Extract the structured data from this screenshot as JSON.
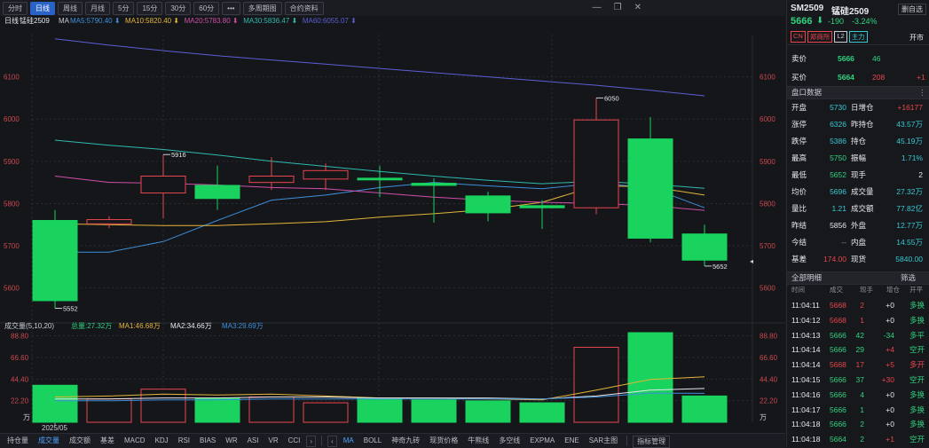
{
  "toolbar": {
    "periods": [
      "分时",
      "日线",
      "周线",
      "月线",
      "5分",
      "15分",
      "30分",
      "60分",
      "•••",
      "多周期图",
      "合约资料"
    ],
    "active_period": "日线"
  },
  "chart_header": {
    "period_label": "日线",
    "instrument": "锰硅2509",
    "ma_prefix": "MA",
    "ma": [
      {
        "label": "MA5:5790.40",
        "color": "#3d8fd9"
      },
      {
        "label": "MA10:5820.40",
        "color": "#e3b53a"
      },
      {
        "label": "MA20:5783.80",
        "color": "#cf4fa8"
      },
      {
        "label": "MA30:5836.47",
        "color": "#2fb9b0"
      },
      {
        "label": "MA60:6055.07",
        "color": "#5b5fd6"
      }
    ]
  },
  "vol_header": {
    "title": "成交量(5,10,20)",
    "total": "总量:27.32万",
    "ma": [
      {
        "label": "MA1:46.68万",
        "color": "#e3b53a"
      },
      {
        "label": "MA2:34.66万",
        "color": "#e6e8ec"
      },
      {
        "label": "MA3:29.69万",
        "color": "#3d8fd9"
      }
    ]
  },
  "chart_data": {
    "type": "candlestick",
    "y_ticks": [
      5600,
      5700,
      5800,
      5900,
      6000,
      6100
    ],
    "ylim": [
      5530,
      6200
    ],
    "candles": [
      {
        "o": 5760,
        "h": 5785,
        "l": 5552,
        "c": 5570
      },
      {
        "o": 5752,
        "h": 5770,
        "l": 5742,
        "c": 5762
      },
      {
        "o": 5825,
        "h": 5916,
        "l": 5765,
        "c": 5865
      },
      {
        "o": 5843,
        "h": 5890,
        "l": 5785,
        "c": 5812
      },
      {
        "o": 5850,
        "h": 5910,
        "l": 5832,
        "c": 5865
      },
      {
        "o": 5858,
        "h": 5895,
        "l": 5832,
        "c": 5878
      },
      {
        "o": 5860,
        "h": 5890,
        "l": 5815,
        "c": 5856
      },
      {
        "o": 5848,
        "h": 5860,
        "l": 5755,
        "c": 5843
      },
      {
        "o": 5818,
        "h": 5828,
        "l": 5758,
        "c": 5778
      },
      {
        "o": 5795,
        "h": 5808,
        "l": 5740,
        "c": 5790
      },
      {
        "o": 5790,
        "h": 6050,
        "l": 5775,
        "c": 5998
      },
      {
        "o": 5953,
        "h": 6005,
        "l": 5708,
        "c": 5718
      },
      {
        "o": 5728,
        "h": 5750,
        "l": 5652,
        "c": 5666
      }
    ],
    "annotations": [
      {
        "candle": 0,
        "price": 5552,
        "label": "5552"
      },
      {
        "candle": 2,
        "price": 5916,
        "label": "5916"
      },
      {
        "candle": 10,
        "price": 6050,
        "label": "6050"
      },
      {
        "candle": 12,
        "price": 5652,
        "label": "5652"
      }
    ],
    "ma_series": [
      {
        "name": "MA5",
        "color": "#3d8fd9",
        "values": [
          5685,
          5685,
          5710,
          5760,
          5808,
          5820,
          5838,
          5850,
          5842,
          5835,
          5848,
          5838,
          5790
        ]
      },
      {
        "name": "MA10",
        "color": "#e3b53a",
        "values": [
          5752,
          5750,
          5748,
          5748,
          5752,
          5757,
          5768,
          5776,
          5786,
          5803,
          5842,
          5840,
          5820
        ]
      },
      {
        "name": "MA20",
        "color": "#cf4fa8",
        "values": [
          5865,
          5850,
          5848,
          5844,
          5838,
          5835,
          5825,
          5815,
          5808,
          5803,
          5800,
          5795,
          5784
        ]
      },
      {
        "name": "MA30",
        "color": "#2fb9b0",
        "values": [
          5950,
          5938,
          5928,
          5915,
          5900,
          5888,
          5876,
          5865,
          5855,
          5847,
          5853,
          5846,
          5836
        ]
      },
      {
        "name": "MA60",
        "color": "#5b5fd6",
        "values": [
          6190,
          6175,
          6162,
          6150,
          6140,
          6130,
          6120,
          6110,
          6100,
          6090,
          6080,
          6068,
          6055
        ]
      }
    ],
    "volume": {
      "unit": "万",
      "y_ticks": [
        22.2,
        44.4,
        66.6,
        88.8
      ],
      "tick_labels": [
        "22.20",
        "44.40",
        "66.60",
        "88.80"
      ],
      "ylim": [
        0,
        92
      ],
      "values": [
        38,
        24,
        34,
        25,
        26,
        20,
        25,
        23,
        22,
        20,
        77,
        92,
        27
      ],
      "ma1": [
        26,
        27,
        29,
        28,
        29,
        27,
        25,
        25,
        24,
        23,
        33,
        44,
        46.68
      ],
      "ma2": [
        24,
        24,
        25,
        25,
        26,
        26,
        25,
        25,
        25,
        24,
        27,
        33,
        34.66
      ],
      "ma3": [
        22,
        22,
        23,
        23,
        24,
        24,
        24,
        24,
        24,
        24,
        26,
        30,
        29.69
      ]
    },
    "x_label": "2025/05"
  },
  "bottom_tabs": [
    "持仓量",
    "成交量",
    "成交额",
    "基差",
    "MACD",
    "KDJ",
    "RSI",
    "BIAS",
    "WR",
    "ASI",
    "VR",
    "CCI"
  ],
  "bottom_tabs_active": "成交量",
  "bottom_tabs_right": [
    "MA",
    "BOLL",
    "神奇九砖",
    "现货价格",
    "牛熊线",
    "多空线",
    "EXPMA",
    "ENE",
    "SAR主图"
  ],
  "bottom_tabs_right_active": "MA",
  "indicator_btn": "指标管理",
  "quote": {
    "code": "SM2509",
    "name": "锰硅2509",
    "add_fav": "删自选",
    "price": "5666",
    "change": "-190",
    "change_pct": "-3.24%",
    "tags": [
      "CN",
      "郑商所",
      "L2",
      "主力"
    ],
    "open_status": "开市",
    "ask_label": "卖价",
    "ask": "5666",
    "ask_vol": "46",
    "bid_label": "买价",
    "bid": "5664",
    "bid_vol": "208",
    "bid_chg": "+1",
    "panel_title": "盘口数据",
    "stats": [
      {
        "l": "开盘",
        "v": "5730",
        "l2": "日增仓",
        "v2": "+16177"
      },
      {
        "l": "涨停",
        "v": "6326",
        "l2": "昨持仓",
        "v2": "43.57万"
      },
      {
        "l": "跌停",
        "v": "5386",
        "l2": "持仓",
        "v2": "45.19万"
      },
      {
        "l": "最高",
        "v": "5750",
        "l2": "振幅",
        "v2": "1.71%"
      },
      {
        "l": "最低",
        "v": "5652",
        "l2": "现手",
        "v2": "2"
      },
      {
        "l": "均价",
        "v": "5696",
        "l2": "成交量",
        "v2": "27.32万"
      },
      {
        "l": "量比",
        "v": "1.21",
        "l2": "成交额",
        "v2": "77.82亿"
      },
      {
        "l": "昨结",
        "v": "5856",
        "l2": "外盘",
        "v2": "12.77万"
      },
      {
        "l": "今结",
        "v": "--",
        "l2": "内盘",
        "v2": "14.55万"
      },
      {
        "l": "基差",
        "v": "174.00",
        "l2": "现货",
        "v2": "5840.00"
      }
    ],
    "detail_title": "全部明细",
    "filter_label": "筛选",
    "detail_headers": [
      "时间",
      "成交",
      "现手",
      "增仓",
      "开平"
    ],
    "ticks": [
      {
        "t": "11:04:11",
        "p": "5668",
        "q": "2",
        "d": "+0",
        "k": "多换"
      },
      {
        "t": "11:04:12",
        "p": "5668",
        "q": "1",
        "d": "+0",
        "k": "多换"
      },
      {
        "t": "11:04:13",
        "p": "5666",
        "q": "42",
        "d": "-34",
        "k": "多平"
      },
      {
        "t": "11:04:14",
        "p": "5666",
        "q": "29",
        "d": "+4",
        "k": "空开"
      },
      {
        "t": "11:04:14",
        "p": "5668",
        "q": "17",
        "d": "+5",
        "k": "多开"
      },
      {
        "t": "11:04:15",
        "p": "5666",
        "q": "37",
        "d": "+30",
        "k": "空开"
      },
      {
        "t": "11:04:16",
        "p": "5666",
        "q": "4",
        "d": "+0",
        "k": "多换"
      },
      {
        "t": "11:04:17",
        "p": "5666",
        "q": "1",
        "d": "+0",
        "k": "多换"
      },
      {
        "t": "11:04:18",
        "p": "5666",
        "q": "2",
        "d": "+0",
        "k": "多换"
      },
      {
        "t": "11:04:18",
        "p": "5664",
        "q": "2",
        "d": "+1",
        "k": "空开"
      }
    ]
  }
}
